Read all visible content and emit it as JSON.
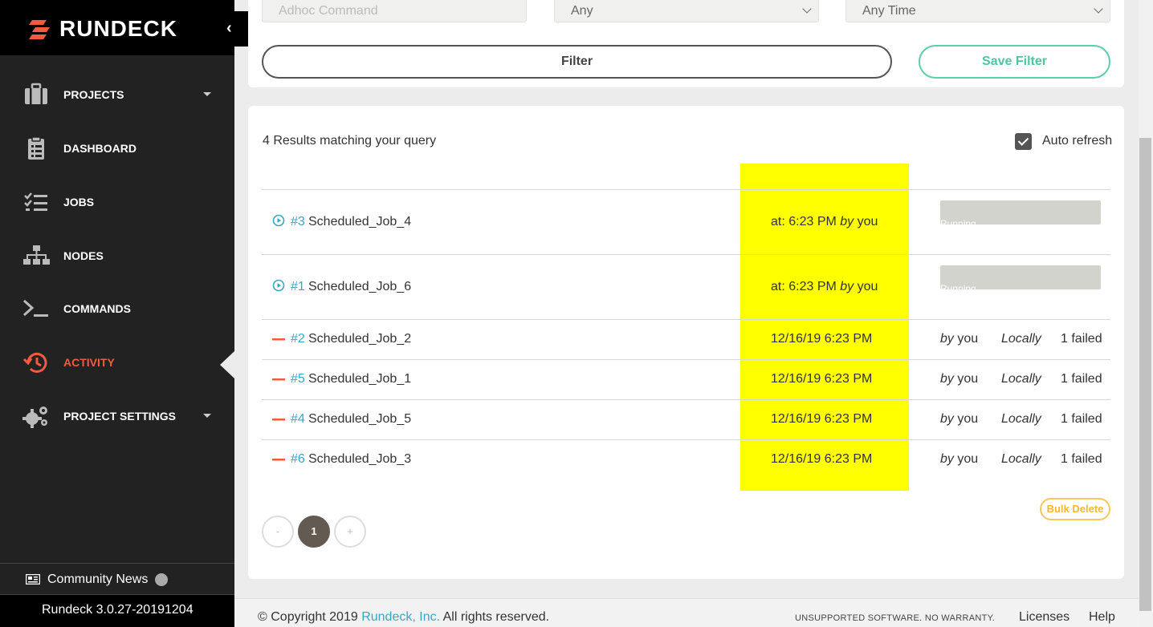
{
  "brand": {
    "name": "RUNDECK"
  },
  "sidebar": {
    "items": [
      {
        "label": "PROJECTS",
        "icon": "briefcase-icon",
        "has_caret": true
      },
      {
        "label": "DASHBOARD",
        "icon": "clipboard-icon",
        "has_caret": false
      },
      {
        "label": "JOBS",
        "icon": "checklist-icon",
        "has_caret": false
      },
      {
        "label": "NODES",
        "icon": "sitemap-icon",
        "has_caret": false
      },
      {
        "label": "COMMANDS",
        "icon": "terminal-icon",
        "has_caret": false
      },
      {
        "label": "ACTIVITY",
        "icon": "history-icon",
        "has_caret": false,
        "active": true
      },
      {
        "label": "PROJECT SETTINGS",
        "icon": "gears-icon",
        "has_caret": true
      }
    ],
    "community_news": "Community News",
    "version": "Rundeck 3.0.27-20191204"
  },
  "filter": {
    "adhoc_placeholder": "Adhoc Command",
    "status_select": "Any",
    "time_select": "Any Time",
    "filter_label": "Filter",
    "save_filter_label": "Save Filter"
  },
  "results": {
    "count_text": "4 Results matching your query",
    "auto_refresh_label": "Auto refresh",
    "auto_refresh_checked": true,
    "rows": [
      {
        "status": "running",
        "id": "#3",
        "name": "Scheduled_Job_4",
        "time_prefix": "at: 6:23 PM",
        "time_by": "by",
        "time_user": "you",
        "progress_label": "Running"
      },
      {
        "status": "running",
        "id": "#1",
        "name": "Scheduled_Job_6",
        "time_prefix": "at: 6:23 PM",
        "time_by": "by",
        "time_user": "you",
        "progress_label": "Running"
      },
      {
        "status": "failed",
        "id": "#2",
        "name": "Scheduled_Job_2",
        "time": "12/16/19 6:23 PM",
        "by": "by",
        "user": "you",
        "node": "Locally",
        "result": "1 failed"
      },
      {
        "status": "failed",
        "id": "#5",
        "name": "Scheduled_Job_1",
        "time": "12/16/19 6:23 PM",
        "by": "by",
        "user": "you",
        "node": "Locally",
        "result": "1 failed"
      },
      {
        "status": "failed",
        "id": "#4",
        "name": "Scheduled_Job_5",
        "time": "12/16/19 6:23 PM",
        "by": "by",
        "user": "you",
        "node": "Locally",
        "result": "1 failed"
      },
      {
        "status": "failed",
        "id": "#6",
        "name": "Scheduled_Job_3",
        "time": "12/16/19 6:23 PM",
        "by": "by",
        "user": "you",
        "node": "Locally",
        "result": "1 failed"
      }
    ],
    "bulk_delete_label": "Bulk Delete",
    "pagination": {
      "prev": "-",
      "current": "1",
      "next": "+"
    }
  },
  "footer": {
    "copyright_prefix": "© Copyright 2019",
    "company_link": "Rundeck, Inc.",
    "copyright_suffix": "All rights reserved.",
    "warranty": "UNSUPPORTED SOFTWARE. NO WARRANTY.",
    "licenses": "Licenses",
    "help": "Help"
  },
  "colors": {
    "accent_active": "#f35b3f",
    "link": "#3aa6c4",
    "save_green": "#4fc59f",
    "highlight": "#ffff00",
    "bulk_delete": "#f5b82e",
    "failed": "#f35b3f"
  }
}
